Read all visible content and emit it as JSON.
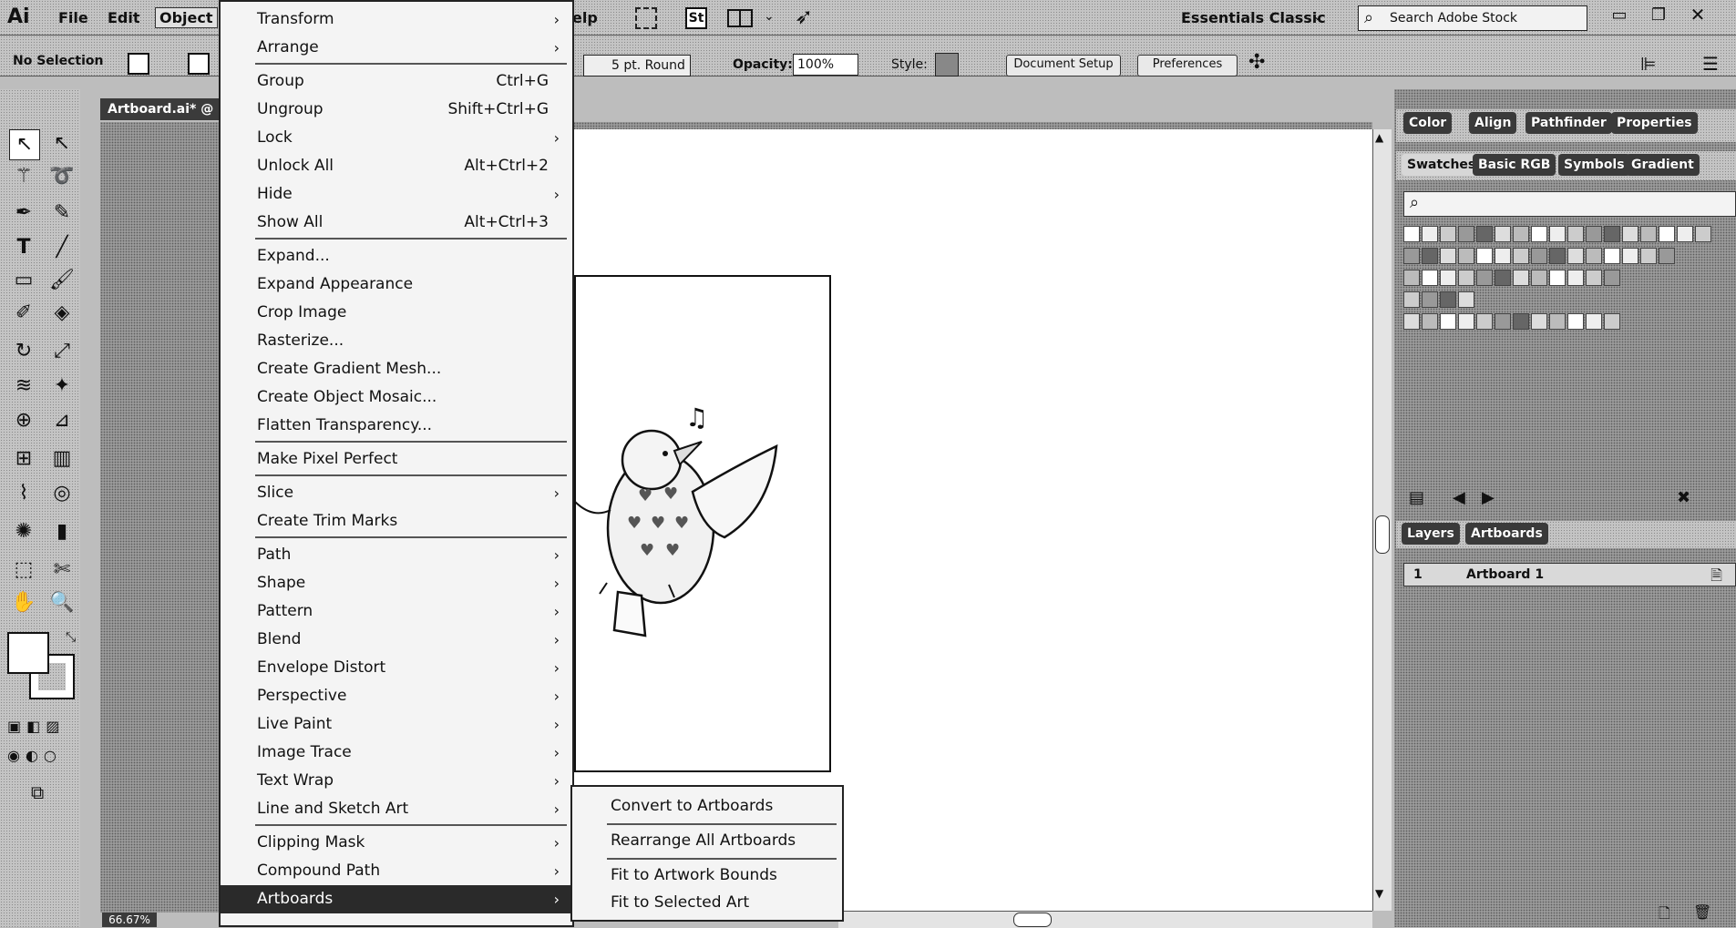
{
  "app": {
    "logo": "Ai"
  },
  "menubar": {
    "file": "File",
    "edit": "Edit",
    "object": "Object",
    "help_partial": "elp"
  },
  "topbar": {
    "st_icon": "St",
    "workspace": "Essentials Classic",
    "search_placeholder": "Search Adobe Stock"
  },
  "controlbar": {
    "selection": "No Selection",
    "stroke_profile": "5 pt. Round",
    "opacity_label": "Opacity:",
    "opacity_value": "100%",
    "style_label": "Style:",
    "document_setup": "Document Setup",
    "preferences": "Preferences"
  },
  "document": {
    "tab_title": "Artboard.ai* @",
    "zoom": "66.67%"
  },
  "object_menu": {
    "items": [
      {
        "label": "Transform",
        "submenu": true
      },
      {
        "label": "Arrange",
        "submenu": true
      },
      {
        "label": "Group",
        "shortcut": "Ctrl+G"
      },
      {
        "label": "Ungroup",
        "shortcut": "Shift+Ctrl+G"
      },
      {
        "label": "Lock",
        "submenu": true
      },
      {
        "label": "Unlock All",
        "shortcut": "Alt+Ctrl+2"
      },
      {
        "label": "Hide",
        "submenu": true
      },
      {
        "label": "Show All",
        "shortcut": "Alt+Ctrl+3"
      },
      {
        "label": "Expand..."
      },
      {
        "label": "Expand Appearance"
      },
      {
        "label": "Crop Image"
      },
      {
        "label": "Rasterize..."
      },
      {
        "label": "Create Gradient Mesh..."
      },
      {
        "label": "Create Object Mosaic..."
      },
      {
        "label": "Flatten Transparency..."
      },
      {
        "label": "Make Pixel Perfect"
      },
      {
        "label": "Slice",
        "submenu": true
      },
      {
        "label": "Create Trim Marks"
      },
      {
        "label": "Path",
        "submenu": true
      },
      {
        "label": "Shape",
        "submenu": true
      },
      {
        "label": "Pattern",
        "submenu": true
      },
      {
        "label": "Blend",
        "submenu": true
      },
      {
        "label": "Envelope Distort",
        "submenu": true
      },
      {
        "label": "Perspective",
        "submenu": true
      },
      {
        "label": "Live Paint",
        "submenu": true
      },
      {
        "label": "Image Trace",
        "submenu": true
      },
      {
        "label": "Text Wrap",
        "submenu": true
      },
      {
        "label": "Line and Sketch Art",
        "submenu": true
      },
      {
        "label": "Clipping Mask",
        "submenu": true
      },
      {
        "label": "Compound Path",
        "submenu": true
      },
      {
        "label": "Artboards",
        "submenu": true,
        "selected": true
      }
    ]
  },
  "artboards_submenu": {
    "items": [
      "Convert to Artboards",
      "Rearrange All Artboards",
      "Fit to Artwork Bounds",
      "Fit to Selected Art"
    ]
  },
  "panels": {
    "top_tabs": [
      "Color",
      "Align",
      "Pathfinder",
      "Properties"
    ],
    "swatch_tabs": [
      "Swatches",
      "Basic RGB",
      "Symbols",
      "Gradient"
    ],
    "layer_tabs": [
      "Layers",
      "Artboards"
    ],
    "artboard_row": {
      "index": "1",
      "name": "Artboard 1"
    }
  },
  "icons": [
    "selection-tool-icon",
    "direct-selection-icon",
    "magic-wand-icon",
    "lasso-icon",
    "pen-icon",
    "curvature-icon",
    "type-icon",
    "line-icon",
    "rectangle-icon",
    "paintbrush-icon",
    "shaper-icon",
    "eraser-icon",
    "rotate-icon",
    "scale-icon",
    "warp-icon",
    "puppet-warp-icon",
    "shape-builder-icon",
    "perspective-icon",
    "mesh-icon",
    "gradient-icon",
    "eyedropper-icon",
    "blend-icon",
    "symbol-sprayer-icon",
    "graph-icon",
    "artboard-tool-icon",
    "slice-icon",
    "hand-icon",
    "zoom-icon",
    "search-icon"
  ]
}
